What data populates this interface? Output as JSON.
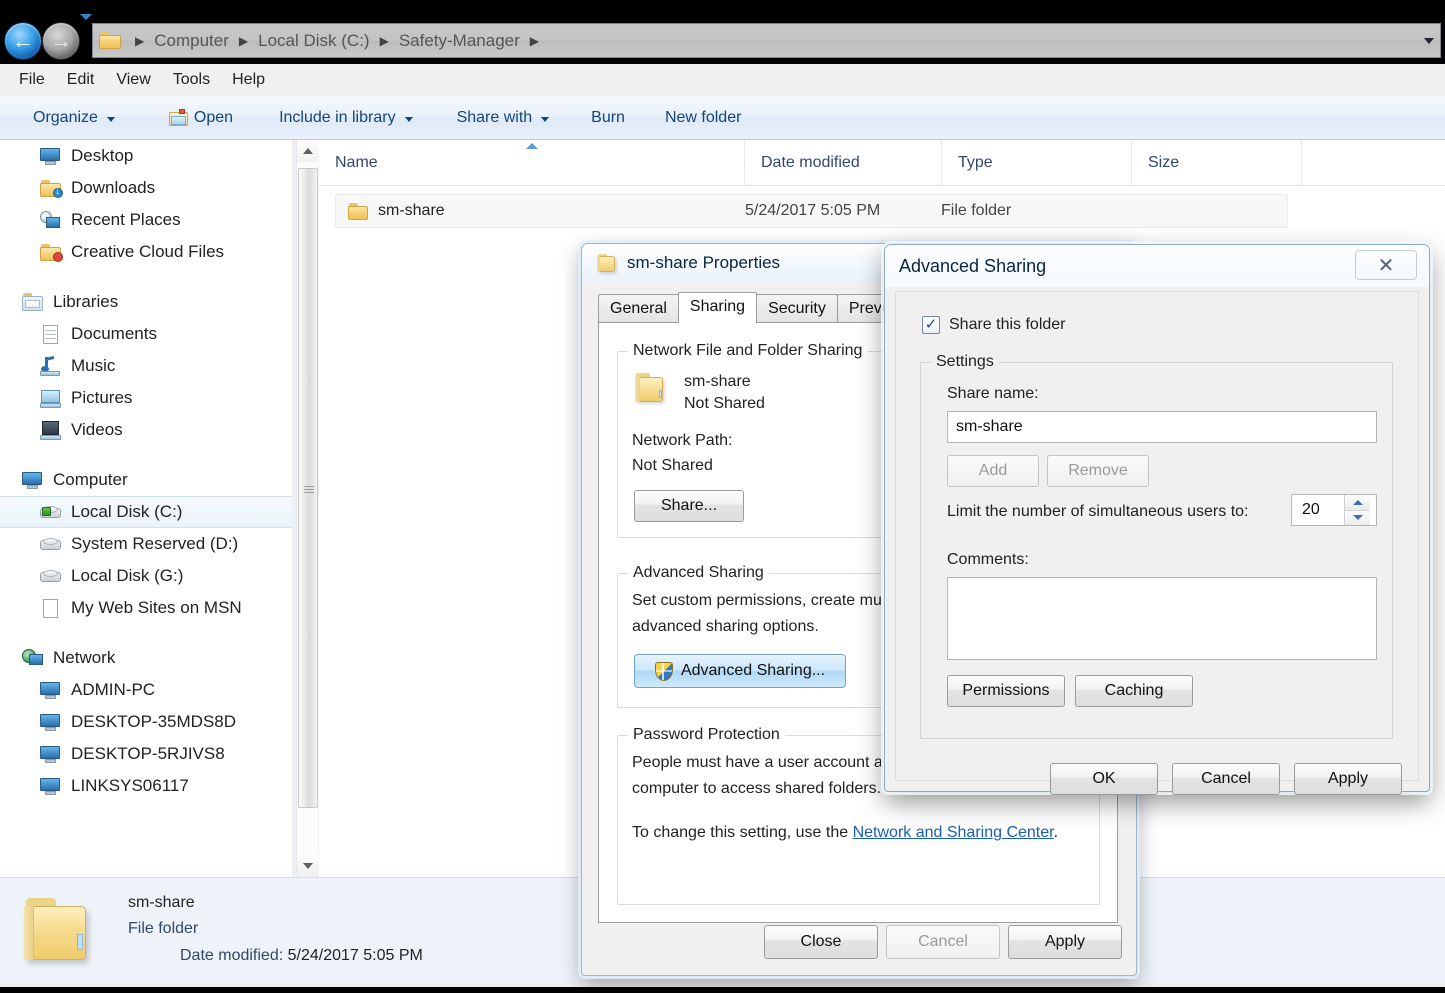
{
  "window": {
    "breadcrumb": [
      "Computer",
      "Local Disk (C:)",
      "Safety-Manager"
    ],
    "menus": [
      "File",
      "Edit",
      "View",
      "Tools",
      "Help"
    ],
    "toolbar": [
      {
        "label": "Organize",
        "caret": true,
        "icon": ""
      },
      {
        "label": "Open",
        "caret": false,
        "icon": "open-folder-icon"
      },
      {
        "label": "Include in library",
        "caret": true,
        "icon": ""
      },
      {
        "label": "Share with",
        "caret": true,
        "icon": ""
      },
      {
        "label": "Burn",
        "caret": false,
        "icon": ""
      },
      {
        "label": "New folder",
        "caret": false,
        "icon": ""
      }
    ]
  },
  "sidebar": {
    "items": [
      {
        "label": "Desktop",
        "icon": "monitor-icon",
        "level": 2,
        "selected": false
      },
      {
        "label": "Downloads",
        "icon": "folder-download-icon",
        "level": 2,
        "selected": false
      },
      {
        "label": "Recent Places",
        "icon": "recent-places-icon",
        "level": 2,
        "selected": false
      },
      {
        "label": "Creative Cloud Files",
        "icon": "folder-creative-cloud-icon",
        "level": 2,
        "selected": false
      },
      {
        "label": "Libraries",
        "icon": "libraries-icon",
        "level": 1,
        "selected": false,
        "spacer_before": true
      },
      {
        "label": "Documents",
        "icon": "documents-icon",
        "level": 2,
        "selected": false
      },
      {
        "label": "Music",
        "icon": "music-icon",
        "level": 2,
        "selected": false
      },
      {
        "label": "Pictures",
        "icon": "pictures-icon",
        "level": 2,
        "selected": false
      },
      {
        "label": "Videos",
        "icon": "videos-icon",
        "level": 2,
        "selected": false
      },
      {
        "label": "Computer",
        "icon": "computer-icon",
        "level": 1,
        "selected": false,
        "spacer_before": true
      },
      {
        "label": "Local Disk (C:)",
        "icon": "local-disk-icon",
        "level": 2,
        "selected": true
      },
      {
        "label": "System Reserved (D:)",
        "icon": "disk-icon",
        "level": 2,
        "selected": false
      },
      {
        "label": "Local Disk (G:)",
        "icon": "disk-icon",
        "level": 2,
        "selected": false
      },
      {
        "label": "My Web Sites on MSN",
        "icon": "document-icon",
        "level": 2,
        "selected": false
      },
      {
        "label": "Network",
        "icon": "network-icon",
        "level": 1,
        "selected": false,
        "spacer_before": true
      },
      {
        "label": "ADMIN-PC",
        "icon": "computer-icon",
        "level": 2,
        "selected": false
      },
      {
        "label": "DESKTOP-35MDS8D",
        "icon": "computer-icon",
        "level": 2,
        "selected": false
      },
      {
        "label": "DESKTOP-5RJIVS8",
        "icon": "computer-icon",
        "level": 2,
        "selected": false
      },
      {
        "label": "LINKSYS06117",
        "icon": "computer-icon",
        "level": 2,
        "selected": false
      }
    ]
  },
  "filelist": {
    "columns": [
      "Name",
      "Date modified",
      "Type",
      "Size"
    ],
    "sorted_column": "Name",
    "rows": [
      {
        "name": "sm-share",
        "date_modified": "5/24/2017 5:05 PM",
        "type": "File folder",
        "size": ""
      }
    ]
  },
  "statusbar": {
    "name": "sm-share",
    "type": "File folder",
    "date_label": "Date modified:",
    "date_value": "5/24/2017 5:05 PM"
  },
  "properties_dialog": {
    "title": "sm-share Properties",
    "tabs": [
      {
        "label": "General",
        "active": false
      },
      {
        "label": "Sharing",
        "active": true
      },
      {
        "label": "Security",
        "active": false
      },
      {
        "label": "Previous V",
        "active": false
      }
    ],
    "network_sharing": {
      "group_label": "Network File and Folder Sharing",
      "folder_name": "sm-share",
      "folder_status": "Not Shared",
      "network_path_label": "Network Path:",
      "network_path_value": "Not Shared",
      "share_button": "Share..."
    },
    "advanced_sharing": {
      "group_label": "Advanced Sharing",
      "description_line1": "Set custom permissions, create mu",
      "description_line2": "advanced sharing options.",
      "button": "Advanced Sharing..."
    },
    "password_protection": {
      "group_label": "Password Protection",
      "line1": "People must have a user account a",
      "line2": "computer to access shared folders.",
      "line3_prefix": "To change this setting, use the ",
      "link": "Network and Sharing Center",
      "line3_suffix": "."
    },
    "footer": {
      "close": "Close",
      "cancel": "Cancel",
      "apply": "Apply"
    }
  },
  "advanced_sharing_dialog": {
    "title": "Advanced Sharing",
    "close_glyph": "✕",
    "share_checkbox_label": "Share this folder",
    "share_checkbox_checked": true,
    "settings_group_label": "Settings",
    "share_name_label": "Share name:",
    "share_name_value": "sm-share",
    "add_button": "Add",
    "remove_button": "Remove",
    "limit_label": "Limit the number of simultaneous users to:",
    "limit_value": "20",
    "comments_label": "Comments:",
    "comments_value": "",
    "permissions_button": "Permissions",
    "caching_button": "Caching",
    "ok_button": "OK",
    "cancel_button": "Cancel",
    "apply_button": "Apply"
  }
}
